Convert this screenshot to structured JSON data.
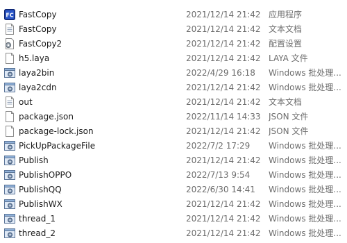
{
  "files": [
    {
      "name": "FastCopy",
      "date": "2021/12/14 21:42",
      "type": "应用程序",
      "icon": "fastcopy-app-icon"
    },
    {
      "name": "FastCopy",
      "date": "2021/12/14 21:42",
      "type": "文本文档",
      "icon": "text-file-icon"
    },
    {
      "name": "FastCopy2",
      "date": "2021/12/14 21:42",
      "type": "配置设置",
      "icon": "config-file-icon"
    },
    {
      "name": "h5.laya",
      "date": "2021/12/14 21:42",
      "type": "LAYA 文件",
      "icon": "blank-file-icon"
    },
    {
      "name": "laya2bin",
      "date": "2022/4/29 16:18",
      "type": "Windows 批处理...",
      "icon": "batch-file-icon"
    },
    {
      "name": "laya2cdn",
      "date": "2021/12/14 21:42",
      "type": "Windows 批处理...",
      "icon": "batch-file-icon"
    },
    {
      "name": "out",
      "date": "2021/12/14 21:42",
      "type": "文本文档",
      "icon": "text-file-icon"
    },
    {
      "name": "package.json",
      "date": "2022/11/14 14:33",
      "type": "JSON 文件",
      "icon": "blank-file-icon"
    },
    {
      "name": "package-lock.json",
      "date": "2021/12/14 21:42",
      "type": "JSON 文件",
      "icon": "blank-file-icon"
    },
    {
      "name": "PickUpPackageFile",
      "date": "2022/7/2 17:29",
      "type": "Windows 批处理...",
      "icon": "batch-file-icon"
    },
    {
      "name": "Publish",
      "date": "2021/12/14 21:42",
      "type": "Windows 批处理...",
      "icon": "batch-file-icon"
    },
    {
      "name": "PublishOPPO",
      "date": "2022/7/13 9:54",
      "type": "Windows 批处理...",
      "icon": "batch-file-icon"
    },
    {
      "name": "PublishQQ",
      "date": "2022/6/30 14:41",
      "type": "Windows 批处理...",
      "icon": "batch-file-icon"
    },
    {
      "name": "PublishWX",
      "date": "2021/12/14 21:42",
      "type": "Windows 批处理...",
      "icon": "batch-file-icon"
    },
    {
      "name": "thread_1",
      "date": "2021/12/14 21:42",
      "type": "Windows 批处理...",
      "icon": "batch-file-icon"
    },
    {
      "name": "thread_2",
      "date": "2021/12/14 21:42",
      "type": "Windows 批处理...",
      "icon": "batch-file-icon"
    }
  ]
}
